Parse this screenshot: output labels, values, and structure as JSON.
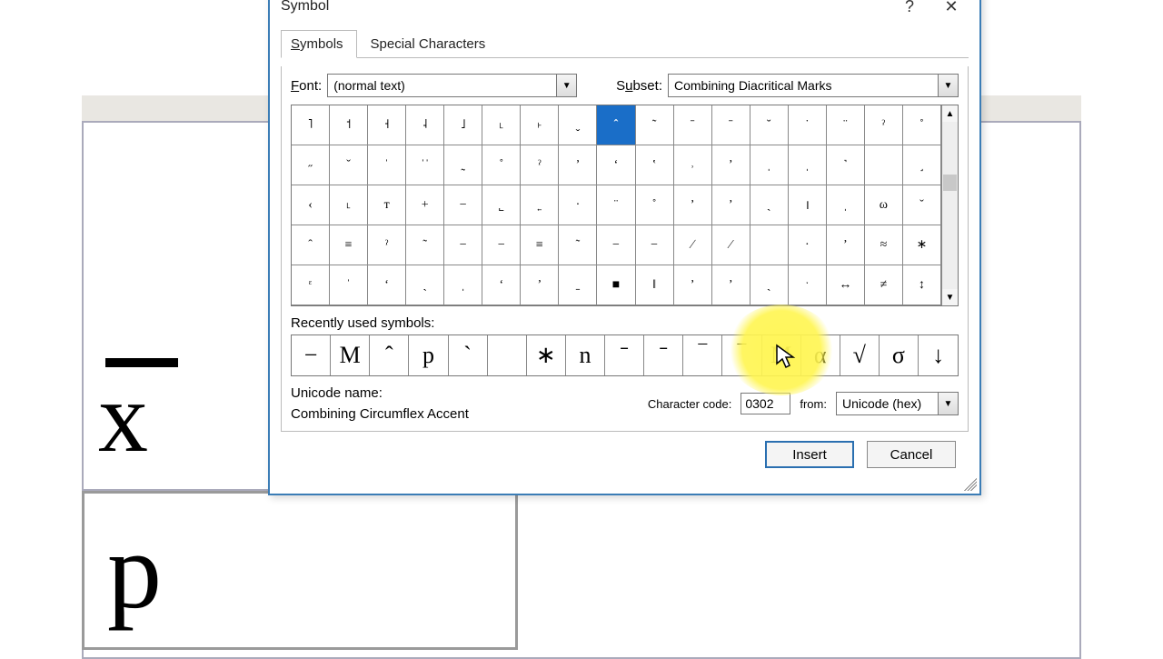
{
  "dialog": {
    "title": "Symbol",
    "help_icon": "?",
    "close_icon": "✕"
  },
  "tabs": {
    "symbols": "Symbols",
    "special": "Special Characters",
    "symbols_underline": "S",
    "special_underline": "P"
  },
  "font": {
    "label_pre": "F",
    "label_rest": "ont:",
    "value": "(normal text)"
  },
  "subset": {
    "label_pre": "S",
    "label_rest": "ubset:",
    "value": "Combining Diacritical Marks"
  },
  "grid": {
    "selected_index": 8,
    "rows": [
      [
        "˥",
        "˦",
        "˧",
        "˨",
        "˩",
        "˪",
        "˫",
        "ˬ",
        "ˆ",
        "˜",
        "ˉ",
        "ˉ",
        "˘",
        "˙",
        "¨",
        "ˀ",
        "˚"
      ],
      [
        "˶",
        "ˇ",
        "ˈ",
        "ˈˈ",
        "˷",
        "˚",
        "ˀ",
        "ʼ",
        "ʻ",
        "ʽ",
        "˒",
        "ʼ",
        "ˌ",
        "ˌ",
        "˺",
        " ",
        "˼"
      ],
      [
        "‹",
        "˪",
        "ᴛ",
        "+",
        "−",
        "˾",
        "˿",
        "·",
        "¨",
        "˚",
        "ʼ",
        "ʼ",
        "ˏ",
        "।",
        "ˌ",
        "ω",
        "ˇ"
      ],
      [
        "ˆ",
        "≡",
        "ˀ",
        "˜",
        "−",
        "−",
        "≡",
        "˜",
        "−",
        "−",
        "∕",
        "⁄",
        " ",
        "·",
        "ʼ",
        "≈",
        "∗"
      ],
      [
        "ᵋ",
        "ˈ",
        "ʻ",
        "ˏ",
        "ˌ",
        "ʻ",
        "ʼ",
        "ˍ",
        "■",
        "ǁ",
        "ʼ",
        "ʼ",
        "ˏ",
        "ˑ",
        "↔",
        "≠",
        "↕"
      ]
    ]
  },
  "recent": {
    "label_pre": "R",
    "label_rest": "ecently used symbols:",
    "items": [
      "−",
      "M",
      "ˆ",
      "p",
      "ˋ",
      " ",
      "∗",
      "n",
      "ˉ",
      "ˉ",
      "‾",
      "‾",
      "M",
      "α",
      "√",
      "σ",
      "↓"
    ]
  },
  "unicode": {
    "label": "Unicode name:",
    "value": "Combining Circumflex Accent"
  },
  "code": {
    "label_pre": "C",
    "label_rest": "haracter code:",
    "value": "0302"
  },
  "from": {
    "label_pre": "fro",
    "label_rest": "m",
    "label_post": ":",
    "value": "Unicode (hex)"
  },
  "buttons": {
    "insert_pre": "I",
    "insert_rest": "nsert",
    "cancel": "Cancel"
  },
  "doc": {
    "x": "x",
    "p": "p"
  }
}
